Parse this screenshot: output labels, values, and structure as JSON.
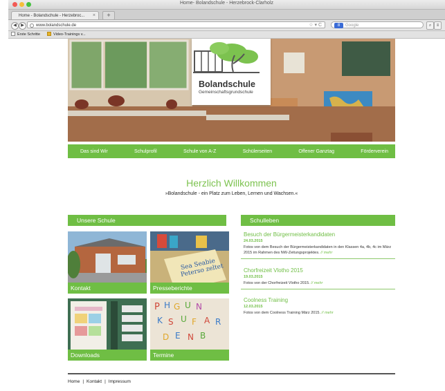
{
  "browser": {
    "window_title": "Home- Bolandschule - Herzebrock-Clarholz",
    "tab_label": "Home - Bolandschule - Herzebroc...",
    "url": "www.bolandschule.de",
    "search_placeholder": "Google",
    "search_engine_badge": "8",
    "bookmarks": [
      "Erste Schritte",
      "Video-Trainings v..."
    ]
  },
  "site": {
    "logo_title": "Bolandschule",
    "logo_subtitle": "Gemeinschaftsgrundschule",
    "nav": [
      "Das sind Wir",
      "Schulprofil",
      "Schule von A-Z",
      "Schülerseiten",
      "Offener Ganztag",
      "Förderverein"
    ],
    "welcome": "Herzlich Willkommen",
    "tagline": "»Bolandschule - ein Platz zum Leben, Lernen und Wachsen.«",
    "left_section_title": "Unsere Schule",
    "tiles": [
      "Kontakt",
      "Presseberichte",
      "Downloads",
      "Termine"
    ],
    "right_section_title": "Schulleben",
    "news": [
      {
        "title": "Besuch der Bürgermeisterkandidaten",
        "date": "24.03.2015",
        "text": "Fotos von dem Besuch der Bürgermeisterkandidaten in den Klassen 4a, 4b, 4c im März 2015 im Rahmen des NW-Zeitungsprojektes.",
        "more": "// mehr"
      },
      {
        "title": "Chorfreizeit Vlotho 2015",
        "date": "19.03.2015",
        "text": "Fotos von der Chorfreizeit Vlotho 2015.",
        "more": "// mehr"
      },
      {
        "title": "Coolness Training",
        "date": "12.03.2015",
        "text": "Fotos von dem Coolness Training März 2015.",
        "more": "// mehr"
      }
    ],
    "footer": [
      "Home",
      "Kontakt",
      "Impressum"
    ],
    "colors": {
      "accent_green": "#6fbe44",
      "heading_green": "#7cc24f"
    }
  }
}
